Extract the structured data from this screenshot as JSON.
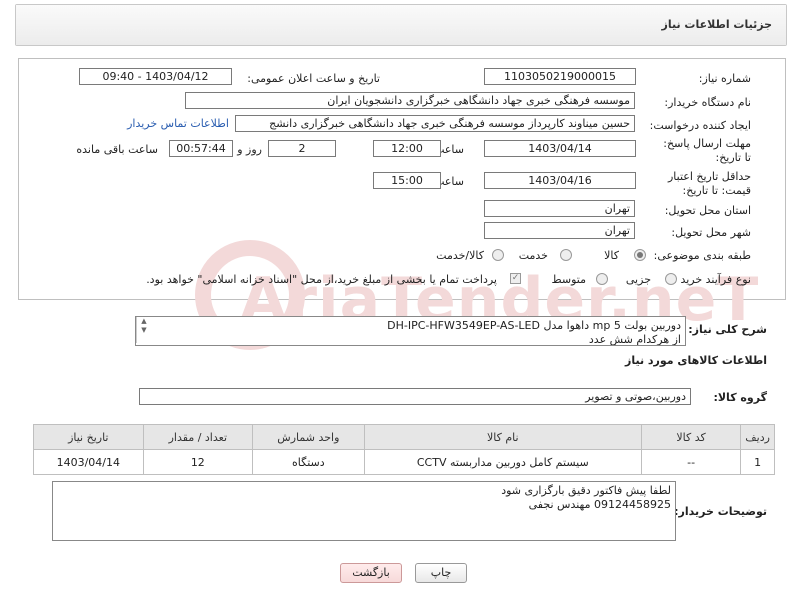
{
  "header": {
    "title": "جزئیات اطلاعات نیاز"
  },
  "form": {
    "need_number_label": "شماره نیاز:",
    "need_number": "1103050219000015",
    "announce_label": "تاریخ و ساعت اعلان عمومی:",
    "announce_value": "1403/04/12 - 09:40",
    "buyer_org_label": "نام دستگاه خریدار:",
    "buyer_org": "موسسه فرهنگی خبری جهاد دانشگاهی خبرگزاری دانشجویان ایران",
    "requester_label": "ایجاد کننده درخواست:",
    "requester": "حسین میناوند کارپرداز موسسه فرهنگی خبری جهاد دانشگاهی خبرگزاری دانشج",
    "contact_link": "اطلاعات تماس خریدار",
    "reply_deadline_label": "مهلت ارسال پاسخ: تا تاریخ:",
    "reply_date": "1403/04/14",
    "time_label": "ساعت",
    "reply_time": "12:00",
    "days_value": "2",
    "days_label": "روز و",
    "remaining_time": "00:57:44",
    "remaining_label": "ساعت باقی مانده",
    "price_validity_label": "حداقل تاریخ اعتبار قیمت: تا تاریخ:",
    "price_date": "1403/04/16",
    "price_time": "15:00",
    "province_label": "استان محل تحویل:",
    "province": "تهران",
    "city_label": "شهر محل تحویل:",
    "city": "تهران",
    "category_label": "طبقه بندی موضوعی:",
    "category_options": [
      "کالا",
      "خدمت",
      "کالا/خدمت"
    ],
    "process_label": "نوع فرآیند خرید :",
    "process_options": [
      "جزیی",
      "متوسط"
    ],
    "payment_note": "پرداخت تمام یا بخشی از مبلغ خرید،از محل \"اسناد خزانه اسلامی\" خواهد بود."
  },
  "summary": {
    "label": "شرح کلی نیاز:",
    "line1": "دوربین بولت 5 mp داهوا مدل DH-IPC-HFW3549EP-AS-LED",
    "line2": "از هرکدام شش عدد"
  },
  "goods": {
    "section_title": "اطلاعات کالاهای مورد نیاز",
    "group_label": "گروه کالا:",
    "group_value": "دوربین،صوتی و تصویر",
    "columns": [
      "ردیف",
      "کد کالا",
      "نام کالا",
      "واحد شمارش",
      "تعداد / مقدار",
      "تاریخ نیاز"
    ],
    "rows": [
      {
        "row": "1",
        "code": "--",
        "name": "سیستم کامل دوربین مداربسته CCTV",
        "unit": "دستگاه",
        "qty": "12",
        "date": "1403/04/14"
      }
    ]
  },
  "notes": {
    "label": "توضیحات خریدار:",
    "line1": "لطفا پیش فاکتور دقیق بارگزاری شود",
    "line2": "09124458925 مهندس نجفی"
  },
  "buttons": {
    "print": "چاپ",
    "back": "بازگشت"
  },
  "watermark": "AriaTender.neT"
}
